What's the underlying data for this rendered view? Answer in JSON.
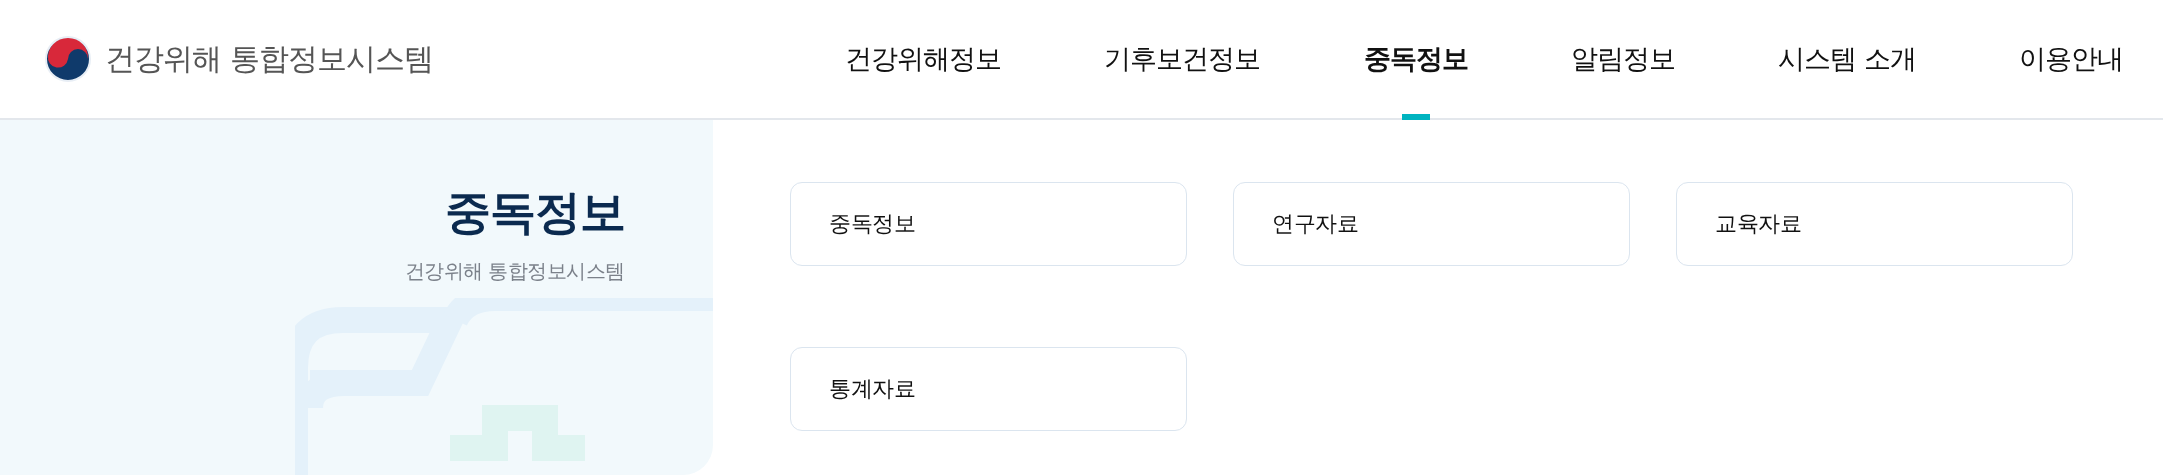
{
  "header": {
    "logo_text": "건강위해 통합정보시스템",
    "nav": [
      {
        "label": "건강위해정보",
        "selected": false
      },
      {
        "label": "기후보건정보",
        "selected": false
      },
      {
        "label": "중독정보",
        "selected": true
      },
      {
        "label": "알림정보",
        "selected": false
      },
      {
        "label": "시스템 소개",
        "selected": false
      },
      {
        "label": "이용안내",
        "selected": false
      }
    ]
  },
  "section": {
    "title": "중독정보",
    "subtitle": "건강위해 통합정보시스템"
  },
  "menu_cards": [
    {
      "label": "중독정보"
    },
    {
      "label": "연구자료"
    },
    {
      "label": "교육자료"
    },
    {
      "label": "통계자료"
    }
  ]
}
